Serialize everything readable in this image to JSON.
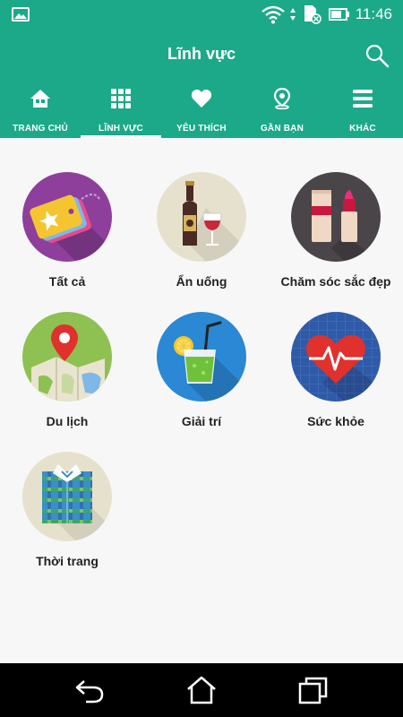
{
  "status_bar": {
    "time": "11:46"
  },
  "app_bar": {
    "title": "Lĩnh vực"
  },
  "tabs": [
    {
      "label": "TRANG CHỦ",
      "icon": "home-icon"
    },
    {
      "label": "LĨNH VỰC",
      "icon": "grid-icon",
      "selected": true
    },
    {
      "label": "YÊU THÍCH",
      "icon": "heart-icon"
    },
    {
      "label": "GẦN BẠN",
      "icon": "location-pin-icon"
    },
    {
      "label": "KHÁC",
      "icon": "menu-icon"
    }
  ],
  "categories": [
    {
      "label": "Tất cả",
      "icon": "tags-icon"
    },
    {
      "label": "Ẩn uống",
      "icon": "wine-icon"
    },
    {
      "label": "Chăm sóc sắc đẹp",
      "icon": "lipstick-icon"
    },
    {
      "label": "Du lịch",
      "icon": "map-pin-icon"
    },
    {
      "label": "Giải trí",
      "icon": "drink-icon"
    },
    {
      "label": "Sức khỏe",
      "icon": "heartbeat-icon"
    },
    {
      "label": "Thời trang",
      "icon": "shirt-icon"
    }
  ],
  "colors": {
    "primary": "#1ba989",
    "background": "#f7f7f7"
  }
}
